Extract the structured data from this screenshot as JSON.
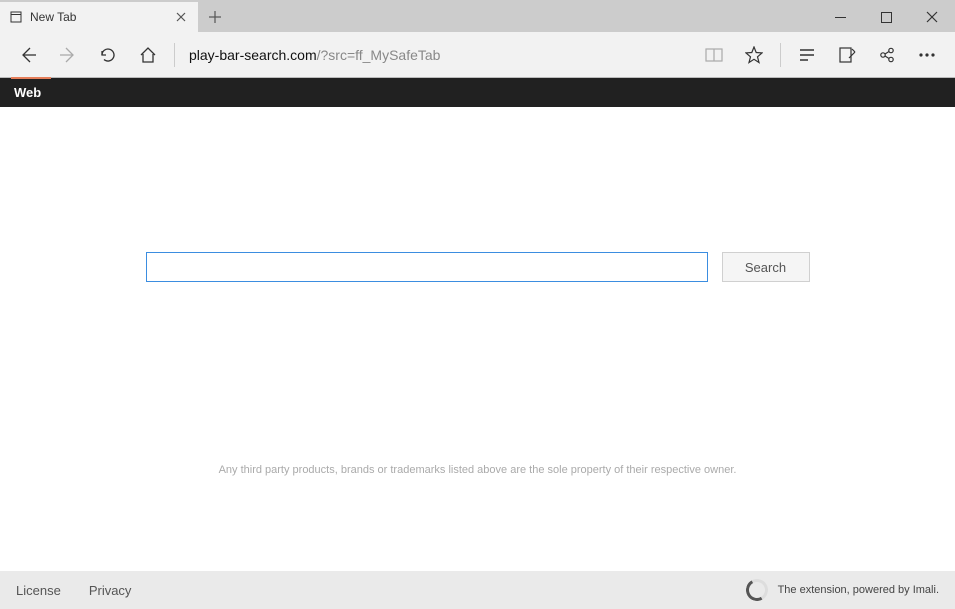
{
  "window": {
    "tab_title": "New Tab"
  },
  "toolbar": {
    "url_main": "play-bar-search.com",
    "url_query": "/?src=ff_MySafeTab"
  },
  "page": {
    "nav_label": "Web",
    "search_button": "Search",
    "search_value": "",
    "disclaimer": "Any third party products, brands or trademarks listed above are the sole property of their respective owner."
  },
  "footer": {
    "license": "License",
    "privacy": "Privacy",
    "powered": "The extension, powered by Imali."
  }
}
